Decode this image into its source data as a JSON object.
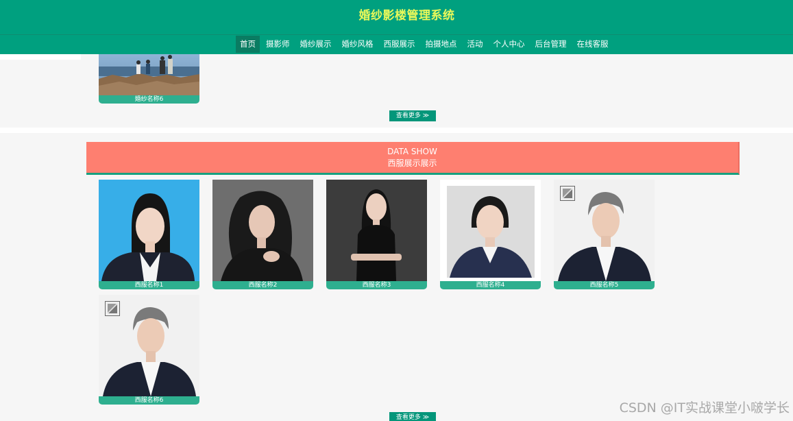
{
  "header": {
    "title": "婚纱影楼管理系统",
    "nav": [
      "首页",
      "摄影师",
      "婚纱展示",
      "婚纱风格",
      "西服展示",
      "拍摄地点",
      "活动",
      "个人中心",
      "后台管理",
      "在线客服"
    ],
    "active_index": 0
  },
  "wedding_section": {
    "last_card": {
      "caption": "婚纱名称6"
    },
    "more_label": "查看更多 ≫"
  },
  "suit_section": {
    "banner_en": "DATA SHOW",
    "banner_cn": "西服展示展示",
    "cards": [
      {
        "caption": "西服名称1"
      },
      {
        "caption": "西服名称2"
      },
      {
        "caption": "西服名称3"
      },
      {
        "caption": "西服名称4"
      },
      {
        "caption": "西服名称5"
      },
      {
        "caption": "西服名称6"
      }
    ],
    "more_label": "查看更多 ≫"
  },
  "watermark": "CSDN @IT实战课堂小啵学长",
  "colors": {
    "header": "#00a07f",
    "title": "#e9f85a",
    "banner": "#fe7f70",
    "caption": "#2eaf8f"
  }
}
